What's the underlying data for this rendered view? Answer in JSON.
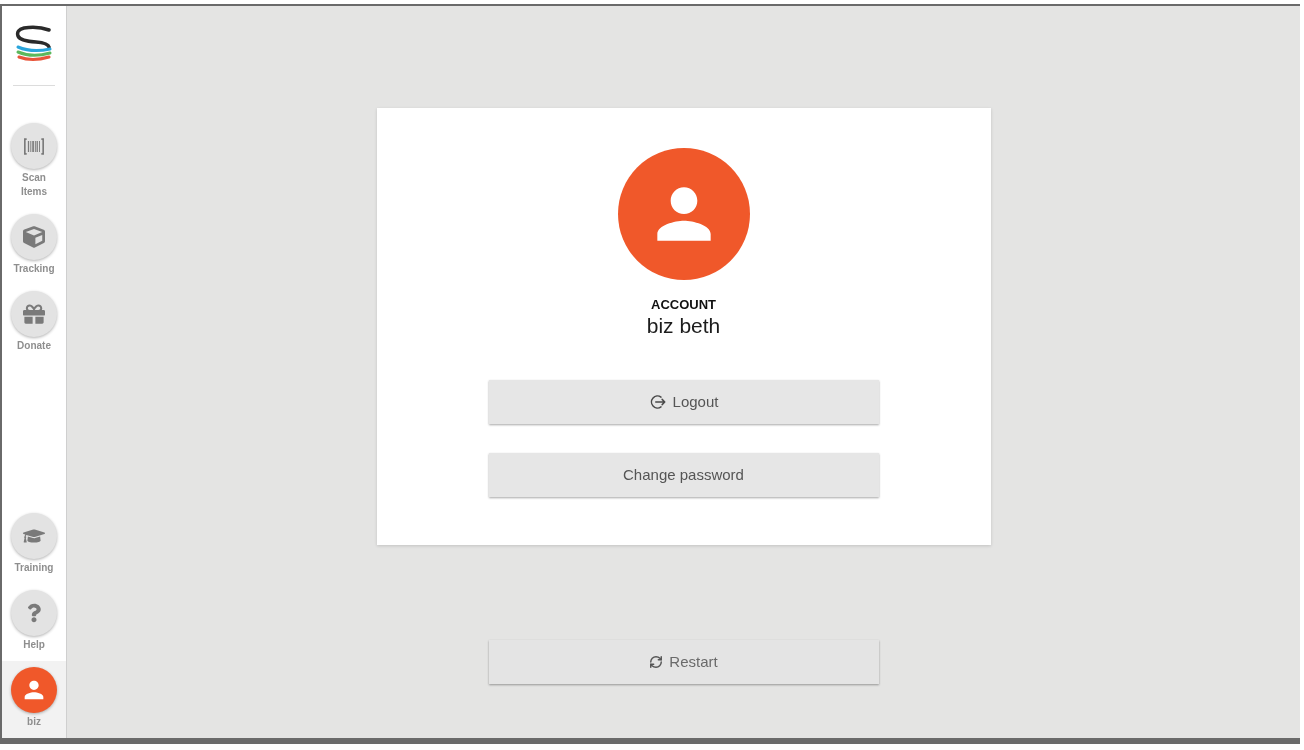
{
  "sidebar": {
    "nav_items": [
      {
        "label": "Scan Items",
        "selected": false
      },
      {
        "label": "Tracking",
        "selected": false
      },
      {
        "label": "Donate",
        "selected": false
      }
    ],
    "bottom_items": [
      {
        "label": "Training",
        "selected": false
      },
      {
        "label": "Help",
        "selected": false
      },
      {
        "label": "biz",
        "selected": true
      }
    ]
  },
  "account_card": {
    "heading": "ACCOUNT",
    "name": "biz beth",
    "buttons": [
      {
        "label": "Logout",
        "kind": "logout"
      },
      {
        "label": "Change password",
        "kind": "plain"
      }
    ]
  },
  "restart_button": {
    "label": "Restart"
  }
}
